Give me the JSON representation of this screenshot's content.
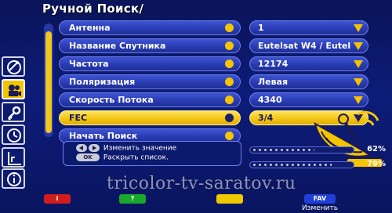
{
  "screen": {
    "title": "Ручной Поиск/"
  },
  "sidebar": {
    "icons": [
      {
        "name": "satellite-icon",
        "active": false
      },
      {
        "name": "camera-icon",
        "active": true
      },
      {
        "name": "key-icon",
        "active": false
      },
      {
        "name": "clock-icon",
        "active": false
      },
      {
        "name": "chart-icon",
        "active": false
      },
      {
        "name": "info-icon",
        "active": false
      }
    ]
  },
  "menu": {
    "rows": [
      {
        "label": "Антенна",
        "value": "1",
        "active": false
      },
      {
        "label": "Название Спутника",
        "value": "Eutelsat W4 / Eutel",
        "active": false
      },
      {
        "label": "Частота",
        "value": "12174",
        "active": false
      },
      {
        "label": "Поляризация",
        "value": "Левая",
        "active": false
      },
      {
        "label": "Скорость Потока",
        "value": "4340",
        "active": false
      },
      {
        "label": "FEC",
        "value": "3/4",
        "active": true
      },
      {
        "label": "Начать Поиск",
        "value": "",
        "active": false
      }
    ]
  },
  "hints": {
    "change_value": "Изменить значение",
    "ok_key": "OK",
    "expand_list": "Раскрыть список."
  },
  "signal": {
    "strength_pct": 62,
    "strength_label": "62%",
    "quality_pct": 79,
    "quality_label": "79%"
  },
  "bottom_bar": {
    "red_label": "i",
    "green_label": "?",
    "yellow_label": "",
    "blue_label": "FAV",
    "blue_caption": "Изменить"
  },
  "watermark": "tricolor-tv-saratov.ru",
  "colors": {
    "background": "#0b1560",
    "accent_yellow": "#f4c400",
    "row_blue": "#2a3cb2"
  }
}
